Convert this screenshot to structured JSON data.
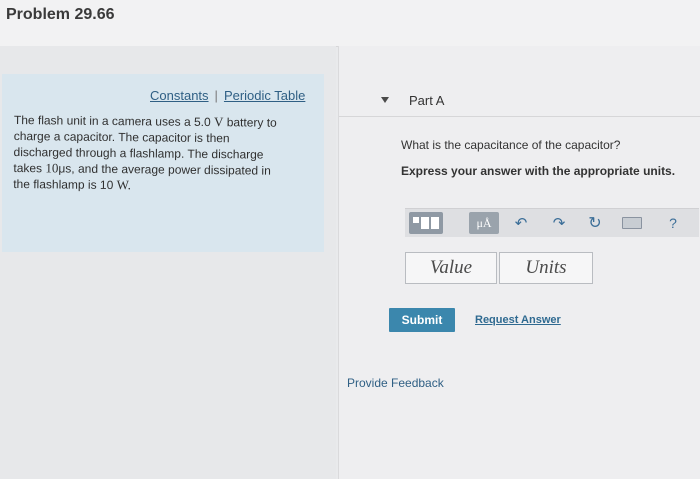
{
  "page": {
    "title": "Problem 29.66"
  },
  "resources": {
    "constants_label": "Constants",
    "separator": "|",
    "periodic_table_label": "Periodic Table"
  },
  "problem": {
    "line1_a": "The flash unit in a camera uses a 5.0 ",
    "line1_b": "V",
    "line1_c": " battery to",
    "line2": "charge a capacitor. The capacitor is then",
    "line3": "discharged through a flashlamp. The discharge",
    "line4_a": "takes ",
    "line4_b": "10",
    "line4_c": "μs",
    "line4_d": ", and the average power dissipated in",
    "line5_a": "the flashlamp is 10 ",
    "line5_b": "W",
    "line5_c": "."
  },
  "part": {
    "label": "Part A",
    "question": "What is the capacitance of the capacitor?",
    "instruction": "Express your answer with the appropriate units."
  },
  "toolbar": {
    "units_label": "μÅ",
    "undo_glyph": "↶",
    "redo_glyph": "↷",
    "reset_glyph": "↻",
    "help_label": "?"
  },
  "answer": {
    "value_placeholder": "Value",
    "units_placeholder": "Units"
  },
  "actions": {
    "submit_label": "Submit",
    "request_answer_label": "Request Answer",
    "feedback_label": "Provide Feedback"
  },
  "icons": {
    "collapse": "caret-down-icon",
    "templates": "templates-icon",
    "undo": "undo-icon",
    "redo": "redo-icon",
    "reset": "reset-icon",
    "keyboard": "keyboard-icon",
    "help": "help-icon"
  },
  "colors": {
    "accent": "#3b87ad",
    "link": "#2f5f84",
    "info_box": "#d9e6ee"
  }
}
